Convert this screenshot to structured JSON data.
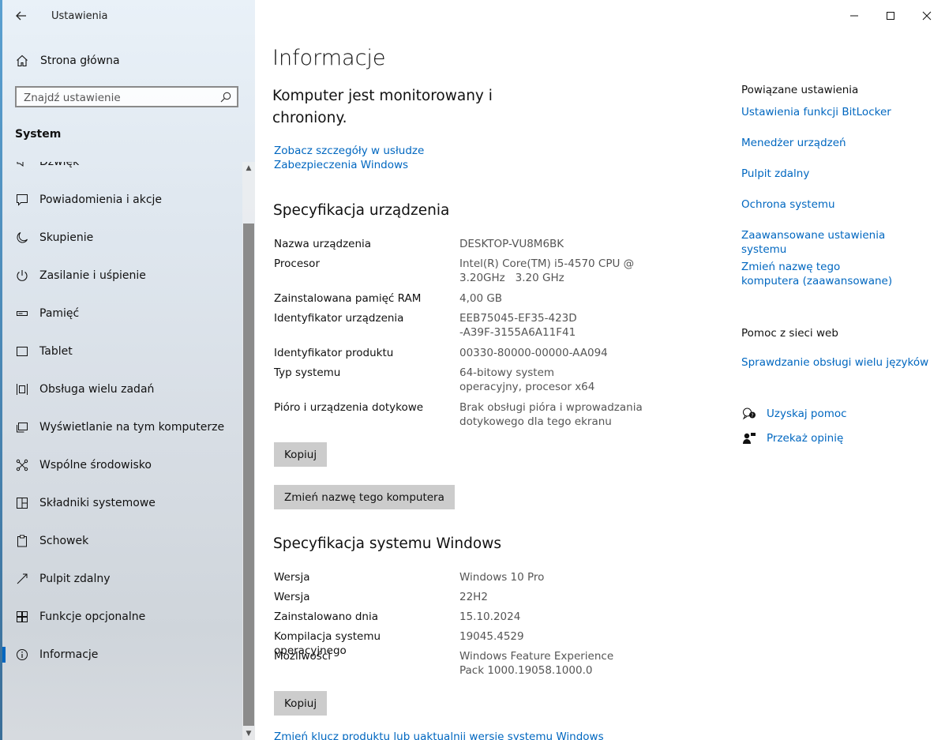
{
  "window": {
    "title": "Ustawienia"
  },
  "sidebar": {
    "home_label": "Strona główna",
    "search_placeholder": "Znajdź ustawienie",
    "section": "System",
    "items": [
      {
        "label": "Dźwięk",
        "icon": "speaker-icon"
      },
      {
        "label": "Powiadomienia i akcje",
        "icon": "notification-icon"
      },
      {
        "label": "Skupienie",
        "icon": "moon-icon"
      },
      {
        "label": "Zasilanie i uśpienie",
        "icon": "power-icon"
      },
      {
        "label": "Pamięć",
        "icon": "storage-icon"
      },
      {
        "label": "Tablet",
        "icon": "tablet-icon"
      },
      {
        "label": "Obsługa wielu zadań",
        "icon": "multitasking-icon"
      },
      {
        "label": "Wyświetlanie na tym komputerze",
        "icon": "projecting-icon"
      },
      {
        "label": "Wspólne środowisko",
        "icon": "shared-experiences-icon"
      },
      {
        "label": "Składniki systemowe",
        "icon": "system-components-icon"
      },
      {
        "label": "Schowek",
        "icon": "clipboard-icon"
      },
      {
        "label": "Pulpit zdalny",
        "icon": "remote-desktop-icon"
      },
      {
        "label": "Funkcje opcjonalne",
        "icon": "optional-features-icon"
      },
      {
        "label": "Informacje",
        "icon": "info-icon",
        "active": true
      }
    ]
  },
  "main": {
    "title": "Informacje",
    "monitor_text": "Komputer jest monitorowany i chroniony.",
    "security_link": "Zobacz szczegóły w usłudze Zabezpieczenia Windows",
    "device_specs": {
      "heading": "Specyfikacja urządzenia",
      "rows": [
        {
          "key": "Nazwa urządzenia",
          "value": "DESKTOP-VU8M6BK"
        },
        {
          "key": "Procesor",
          "value": "Intel(R) Core(TM) i5-4570 CPU @ 3.20GHz   3.20 GHz"
        },
        {
          "key": "Zainstalowana pamięć RAM",
          "value": "4,00 GB"
        },
        {
          "key": "Identyfikator urządzenia",
          "value": "EEB75045-EF35-423D-A39F-3155A6A11F41"
        },
        {
          "key": "Identyfikator produktu",
          "value": "00330-80000-00000-AA094"
        },
        {
          "key": "Typ systemu",
          "value": "64-bitowy system operacyjny, procesor x64"
        },
        {
          "key": "Pióro i urządzenia dotykowe",
          "value": "Brak obsługi pióra i wprowadzania dotykowego dla tego ekranu"
        }
      ],
      "copy_button": "Kopiuj",
      "rename_button": "Zmień nazwę tego komputera"
    },
    "windows_specs": {
      "heading": "Specyfikacja systemu Windows",
      "rows": [
        {
          "key": "Wersja",
          "value": "Windows 10 Pro"
        },
        {
          "key": "Wersja",
          "value": "22H2"
        },
        {
          "key": "Zainstalowano dnia",
          "value": "15.10.2024"
        },
        {
          "key": "Kompilacja systemu operacyjnego",
          "value": "19045.4529"
        },
        {
          "key": "Możliwości",
          "value": "Windows Feature Experience Pack 1000.19058.1000.0"
        }
      ],
      "copy_button": "Kopiuj",
      "product_key_link": "Zmień klucz produktu lub uaktualnij wersję systemu Windows"
    },
    "related": {
      "title": "Powiązane ustawienia",
      "links": [
        "Ustawienia funkcji BitLocker",
        "Menedżer urządzeń",
        "Pulpit zdalny",
        "Ochrona systemu",
        "Zaawansowane ustawienia systemu",
        "Zmień nazwę tego komputera (zaawansowane)"
      ]
    },
    "web_help": {
      "title": "Pomoc z sieci web",
      "link": "Sprawdzanie obsługi wielu języków"
    },
    "help": {
      "get_help": "Uzyskaj pomoc",
      "feedback": "Przekaż opinię"
    }
  },
  "colors": {
    "accent": "#0067c0",
    "button": "#cccccc",
    "scroll_thumb": "#8b8b8b"
  }
}
